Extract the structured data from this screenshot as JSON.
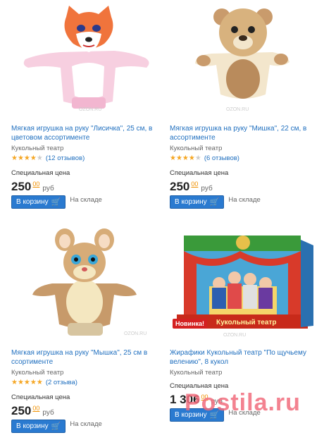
{
  "products": [
    {
      "title": "Мягкая игрушка на руку \"Лисичка\", 25 см, в цветовом ассортименте",
      "subtitle": "Кукольный театр",
      "rating": 4,
      "reviews": "(12 отзывов)",
      "price_label": "Специальная цена",
      "price_int": "250",
      "price_cents": "00",
      "currency": "руб",
      "cart_label": "В корзину",
      "stock": "На складе",
      "watermark": "OZON.RU"
    },
    {
      "title": "Мягкая игрушка на руку \"Мишка\", 22 см, в ассортименте",
      "subtitle": "Кукольный театр",
      "rating": 4,
      "reviews": "(6 отзывов)",
      "price_label": "Специальная цена",
      "price_int": "250",
      "price_cents": "00",
      "currency": "руб",
      "cart_label": "В корзину",
      "stock": "На складе",
      "watermark": "OZON.RU"
    },
    {
      "title": "Мягкая игрушка на руку \"Мышка\", 25 см в ссортименте",
      "subtitle": "Кукольный театр",
      "rating": 5,
      "reviews": "(2 отзыва)",
      "price_label": "Специальная цена",
      "price_int": "250",
      "price_cents": "00",
      "currency": "руб",
      "cart_label": "В корзину",
      "stock": "На складе",
      "watermark": "OZON.RU"
    },
    {
      "title": "Жирафики Кукольный театр \"По щучьему велению\", 8 кукол",
      "subtitle": "Кукольный театр",
      "price_label": "Специальная цена",
      "price_int": "1 306",
      "price_cents": "00",
      "currency": "руб",
      "cart_label": "В корзину",
      "stock": "На складе",
      "watermark": "OZON.RU",
      "badge": "Новинка!",
      "box_text": "Кукольный театр"
    }
  ],
  "overlay": "Postila.ru",
  "colors": {
    "link": "#1f6fbf",
    "button": "#2a7ad0",
    "cents": "#f09000",
    "star": "#f5a623"
  }
}
